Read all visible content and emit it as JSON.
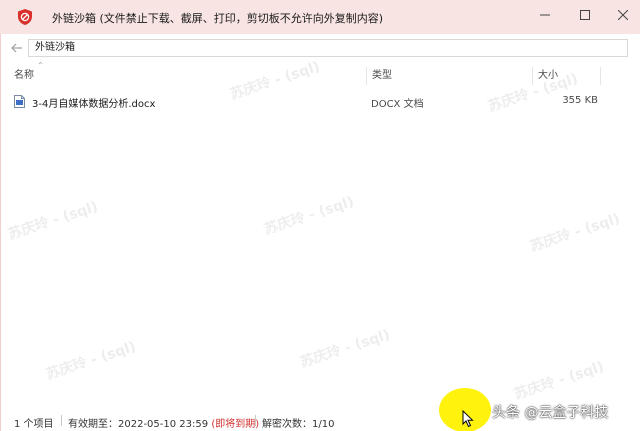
{
  "window": {
    "app_name": "外链沙箱",
    "subtitle": "(文件禁止下载、截屏、打印，剪切板不允许向外复制内容)",
    "controls": {
      "minimize_icon": "minimize-icon",
      "maximize_icon": "maximize-icon",
      "close_icon": "close-icon"
    },
    "accent_color": "#d9302c",
    "titlebar_color": "#f8e5e3"
  },
  "address_bar": {
    "path": "外链沙箱"
  },
  "columns": {
    "name": "名称",
    "type": "类型",
    "size": "大小"
  },
  "files": [
    {
      "name": "3-4月自媒体数据分析.docx",
      "type": "DOCX 文档",
      "size": "355 KB",
      "icon": "docx-file-icon"
    }
  ],
  "watermark_text": "苏庆玲 - (sql)",
  "status": {
    "item_count": "1 个项目",
    "valid_until_label": "有效期至：",
    "valid_until_value": "2022-05-10 23:59",
    "expired_note": "(即将到期)",
    "decrypt_label": "解密次数：",
    "decrypt_value": "1/10"
  },
  "attribution": "头条 @云盒子科技"
}
